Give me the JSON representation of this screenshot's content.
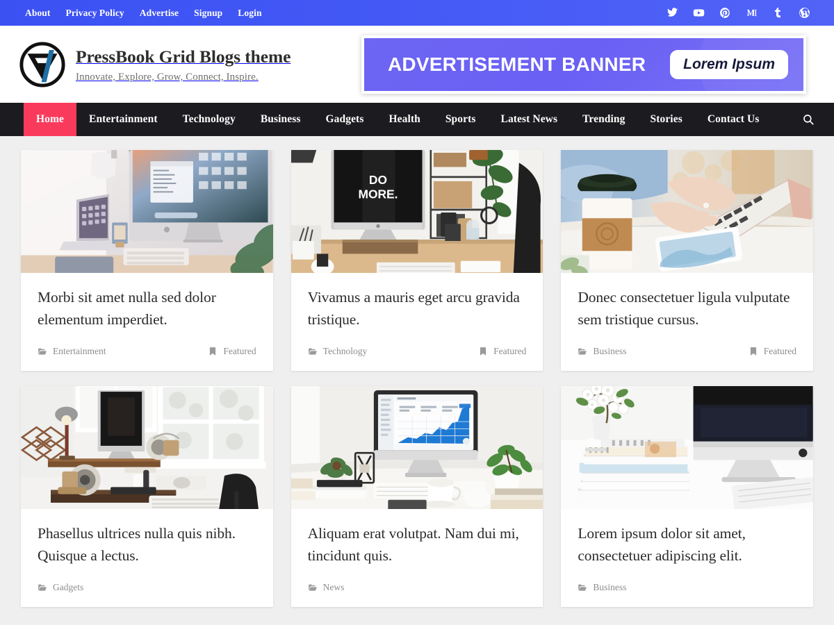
{
  "colors": {
    "topbar_blue": "#3b51f2",
    "ad_purple": "#6d65f3",
    "nav_dark": "#1c1c20",
    "accent_red": "#f93a5c",
    "page_bg": "#efefef",
    "logo_blue": "#1f6fa5"
  },
  "topbar": {
    "links": [
      {
        "label": "About"
      },
      {
        "label": "Privacy Policy"
      },
      {
        "label": "Advertise"
      },
      {
        "label": "Signup"
      },
      {
        "label": "Login"
      }
    ],
    "social": [
      {
        "name": "twitter-icon"
      },
      {
        "name": "youtube-icon"
      },
      {
        "name": "pinterest-icon"
      },
      {
        "name": "medium-icon"
      },
      {
        "name": "tumblr-icon"
      },
      {
        "name": "wordpress-icon"
      }
    ]
  },
  "header": {
    "site_title": "PressBook Grid Blogs theme",
    "tagline": "Innovate, Explore, Grow, Connect, Inspire.",
    "ad": {
      "text": "ADVERTISEMENT BANNER",
      "pill_label": "Lorem Ipsum"
    }
  },
  "mainnav": {
    "items": [
      {
        "label": "Home",
        "active": true
      },
      {
        "label": "Entertainment",
        "active": false
      },
      {
        "label": "Technology",
        "active": false
      },
      {
        "label": "Business",
        "active": false
      },
      {
        "label": "Gadgets",
        "active": false
      },
      {
        "label": "Health",
        "active": false
      },
      {
        "label": "Sports",
        "active": false
      },
      {
        "label": "Latest News",
        "active": false
      },
      {
        "label": "Trending",
        "active": false
      },
      {
        "label": "Stories",
        "active": false
      },
      {
        "label": "Contact Us",
        "active": false
      }
    ],
    "search_icon": "search-icon"
  },
  "posts": [
    {
      "title": "Morbi sit amet nulla sed dolor elementum imperdiet.",
      "category": "Entertainment",
      "badge": "Featured",
      "has_badge": true,
      "image_alt": "Desk with iMac, laptop, lamp and plant"
    },
    {
      "title": "Vivamus a mauris eget arcu gravida tristique.",
      "category": "Technology",
      "badge": "Featured",
      "has_badge": true,
      "image_alt": "iMac screen showing DO MORE. on a wooden desk"
    },
    {
      "title": "Donec consectetuer ligula vulputate sem tristique cursus.",
      "category": "Business",
      "badge": "Featured",
      "has_badge": true,
      "image_alt": "Hands typing on laptop beside a coffee cup and phone"
    },
    {
      "title": "Phasellus ultrices nulla quis nibh. Quisque a lectus.",
      "category": "Gadgets",
      "badge": "",
      "has_badge": false,
      "image_alt": "Bright workspace with windows, iMac and speakers"
    },
    {
      "title": "Aliquam erat volutpat. Nam dui mi, tincidunt quis.",
      "category": "News",
      "badge": "",
      "has_badge": false,
      "image_alt": "iMac showing a blue area chart between two potted plants"
    },
    {
      "title": "Lorem ipsum dolor sit amet, consectetuer adipiscing elit.",
      "category": "Business",
      "badge": "",
      "has_badge": false,
      "image_alt": "White desk with stacked books, blossom branch and iMac"
    }
  ],
  "icons": {
    "category": "folder-icon",
    "badge": "bookmark-icon"
  }
}
